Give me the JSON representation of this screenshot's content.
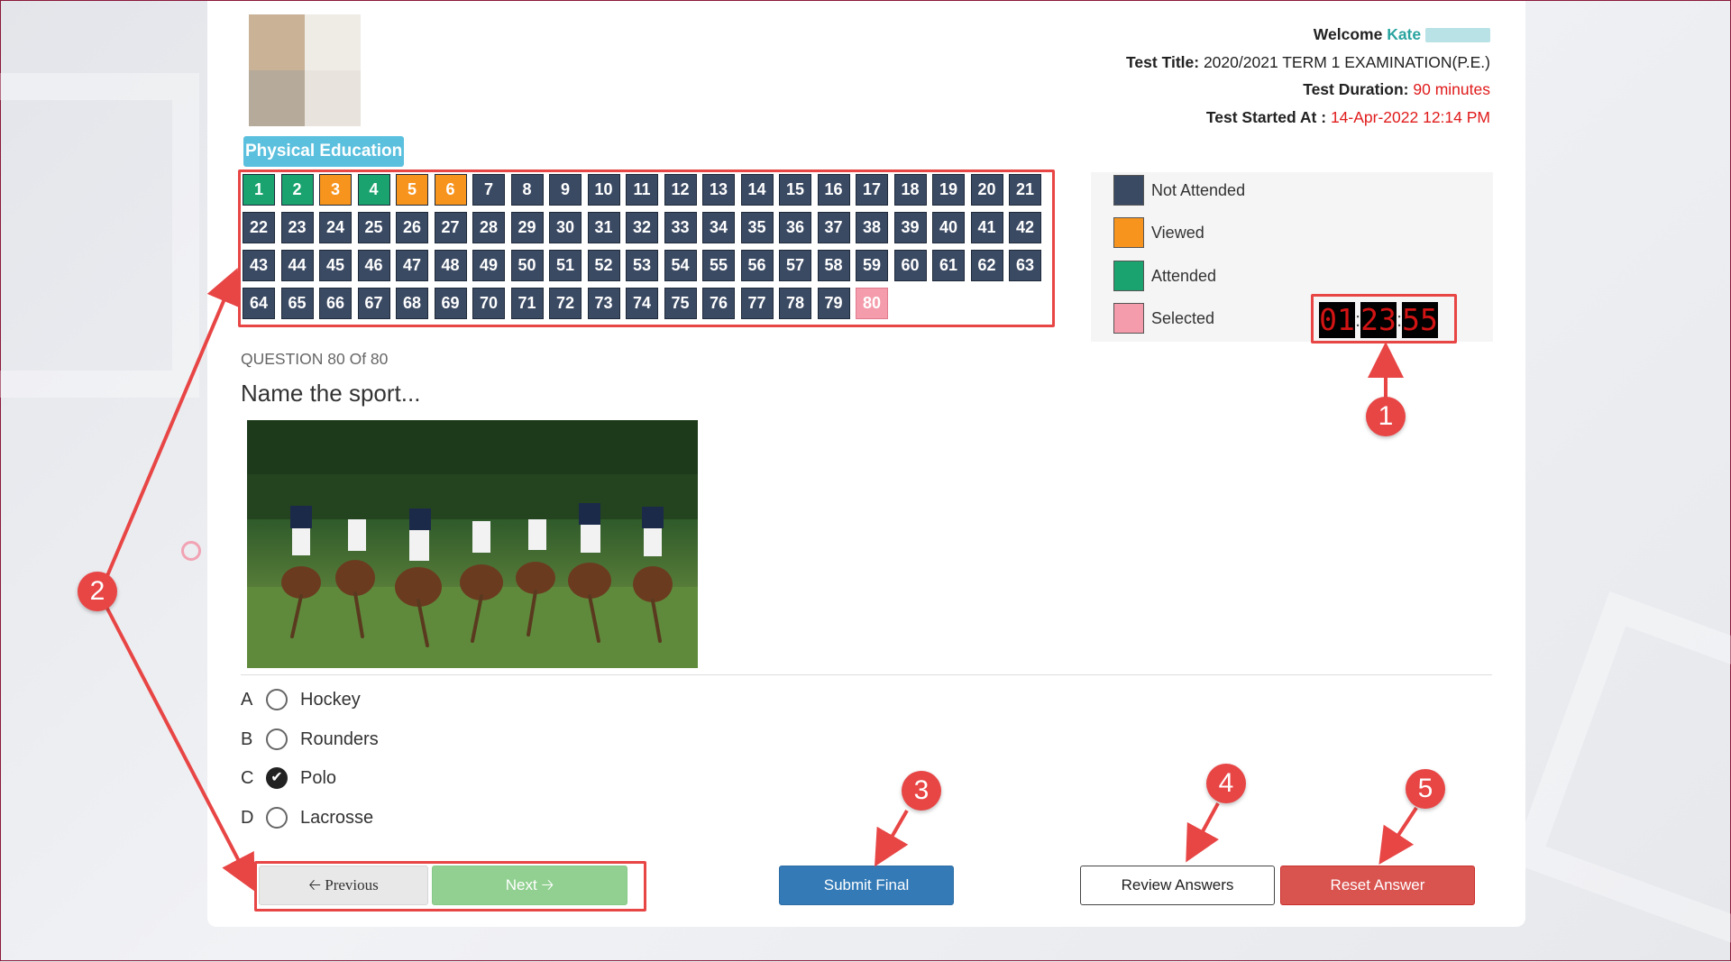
{
  "header": {
    "welcome_label": "Welcome",
    "user_name": "Kate",
    "test_title_label": "Test Title:",
    "test_title": "2020/2021 TERM 1 EXAMINATION(P.E.)",
    "duration_label": "Test Duration:",
    "duration": "90 minutes",
    "started_label": "Test Started At :",
    "started": "14-Apr-2022 12:14 PM"
  },
  "subject": "Physical Education",
  "question_grid": {
    "attended": [
      1,
      2,
      4
    ],
    "viewed": [
      3,
      5,
      6
    ],
    "selected": [
      80
    ],
    "total": 80
  },
  "legend": {
    "not_attended": "Not Attended",
    "viewed": "Viewed",
    "attended": "Attended",
    "selected": "Selected"
  },
  "timer": {
    "hours": "01",
    "minutes": "23",
    "seconds": "55"
  },
  "question": {
    "counter": "QUESTION 80 Of 80",
    "text": "Name the sport..."
  },
  "options": [
    {
      "letter": "A",
      "label": "Hockey",
      "checked": false
    },
    {
      "letter": "B",
      "label": "Rounders",
      "checked": false
    },
    {
      "letter": "C",
      "label": "Polo",
      "checked": true
    },
    {
      "letter": "D",
      "label": "Lacrosse",
      "checked": false
    }
  ],
  "buttons": {
    "previous": "Previous",
    "next": "Next",
    "submit": "Submit Final",
    "review": "Review Answers",
    "reset": "Reset Answer"
  },
  "annotations": [
    "1",
    "2",
    "3",
    "4",
    "5"
  ],
  "colors": {
    "not_attended": "#3b4a63",
    "viewed": "#f7941d",
    "attended": "#1aa36e",
    "selected": "#f49cab",
    "annotation": "#e84545"
  }
}
